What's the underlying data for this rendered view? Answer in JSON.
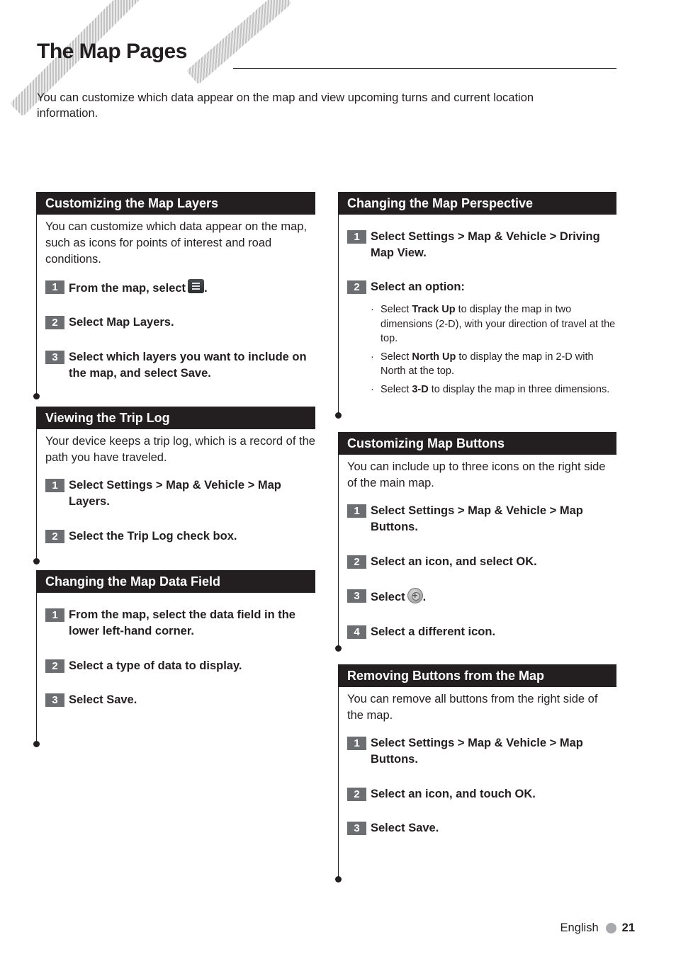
{
  "page": {
    "title": "The Map Pages",
    "intro": "You can customize which data appear on the map and view upcoming turns and current location information."
  },
  "sections": [
    {
      "heading": "Customizing the Map Layers",
      "description": "You can customize which data appear on the map, such as icons for points of interest and road conditions.",
      "steps": [
        {
          "num": "1",
          "text": "From the map, select",
          "icon": "menu-icon",
          "suffix": "."
        },
        {
          "num": "2",
          "text": "Select Map Layers."
        },
        {
          "num": "3",
          "text": "Select which layers you want to include on the map, and select Save."
        }
      ]
    },
    {
      "heading": "Viewing the Trip Log",
      "description": "Your device keeps a trip log, which is a record of the path you have traveled.",
      "steps": [
        {
          "num": "1",
          "text": "Select Settings > Map & Vehicle > Map Layers."
        },
        {
          "num": "2",
          "text": "Select the Trip Log check box."
        }
      ]
    },
    {
      "heading": "Changing the Map Data Field",
      "steps": [
        {
          "num": "1",
          "text": "From the map, select the data field in the lower left-hand corner."
        },
        {
          "num": "2",
          "text": "Select a type of data to display."
        },
        {
          "num": "3",
          "text": "Select Save."
        }
      ]
    },
    {
      "heading": "Changing the Map Perspective",
      "steps": [
        {
          "num": "1",
          "text": "Select Settings > Map & Vehicle > Driving Map View."
        },
        {
          "num": "2",
          "text": "Select an option:"
        }
      ],
      "options": [
        {
          "pre": "Select ",
          "bold": "Track Up",
          "post": " to display the map in two dimensions (2-D), with your direction of travel at the top."
        },
        {
          "pre": "Select ",
          "bold": "North Up",
          "post": " to display the map in 2-D with North at the top."
        },
        {
          "pre": "Select ",
          "bold": "3-D",
          "post": " to display the map in three dimensions."
        }
      ]
    },
    {
      "heading": "Customizing Map Buttons",
      "description": "You can include up to three icons on the right side of the main map.",
      "steps": [
        {
          "num": "1",
          "text": "Select Settings > Map & Vehicle > Map Buttons."
        },
        {
          "num": "2",
          "text": "Select an icon, and select OK."
        },
        {
          "num": "3",
          "text": "Select",
          "icon": "add-icon",
          "suffix": "."
        },
        {
          "num": "4",
          "text": "Select a different icon."
        }
      ]
    },
    {
      "heading": "Removing Buttons from the Map",
      "description": "You can remove all buttons from the right side of the map.",
      "steps": [
        {
          "num": "1",
          "text": "Select Settings > Map & Vehicle > Map Buttons."
        },
        {
          "num": "2",
          "text": "Select an icon, and touch OK."
        },
        {
          "num": "3",
          "text": "Select Save."
        }
      ]
    }
  ],
  "bullet": "·",
  "footer": {
    "language": "English",
    "page_number": "21"
  },
  "colors": {
    "heading_bar": "#231f20",
    "step_box": "#6d6e71",
    "page_dot": "#a7a9ac"
  }
}
